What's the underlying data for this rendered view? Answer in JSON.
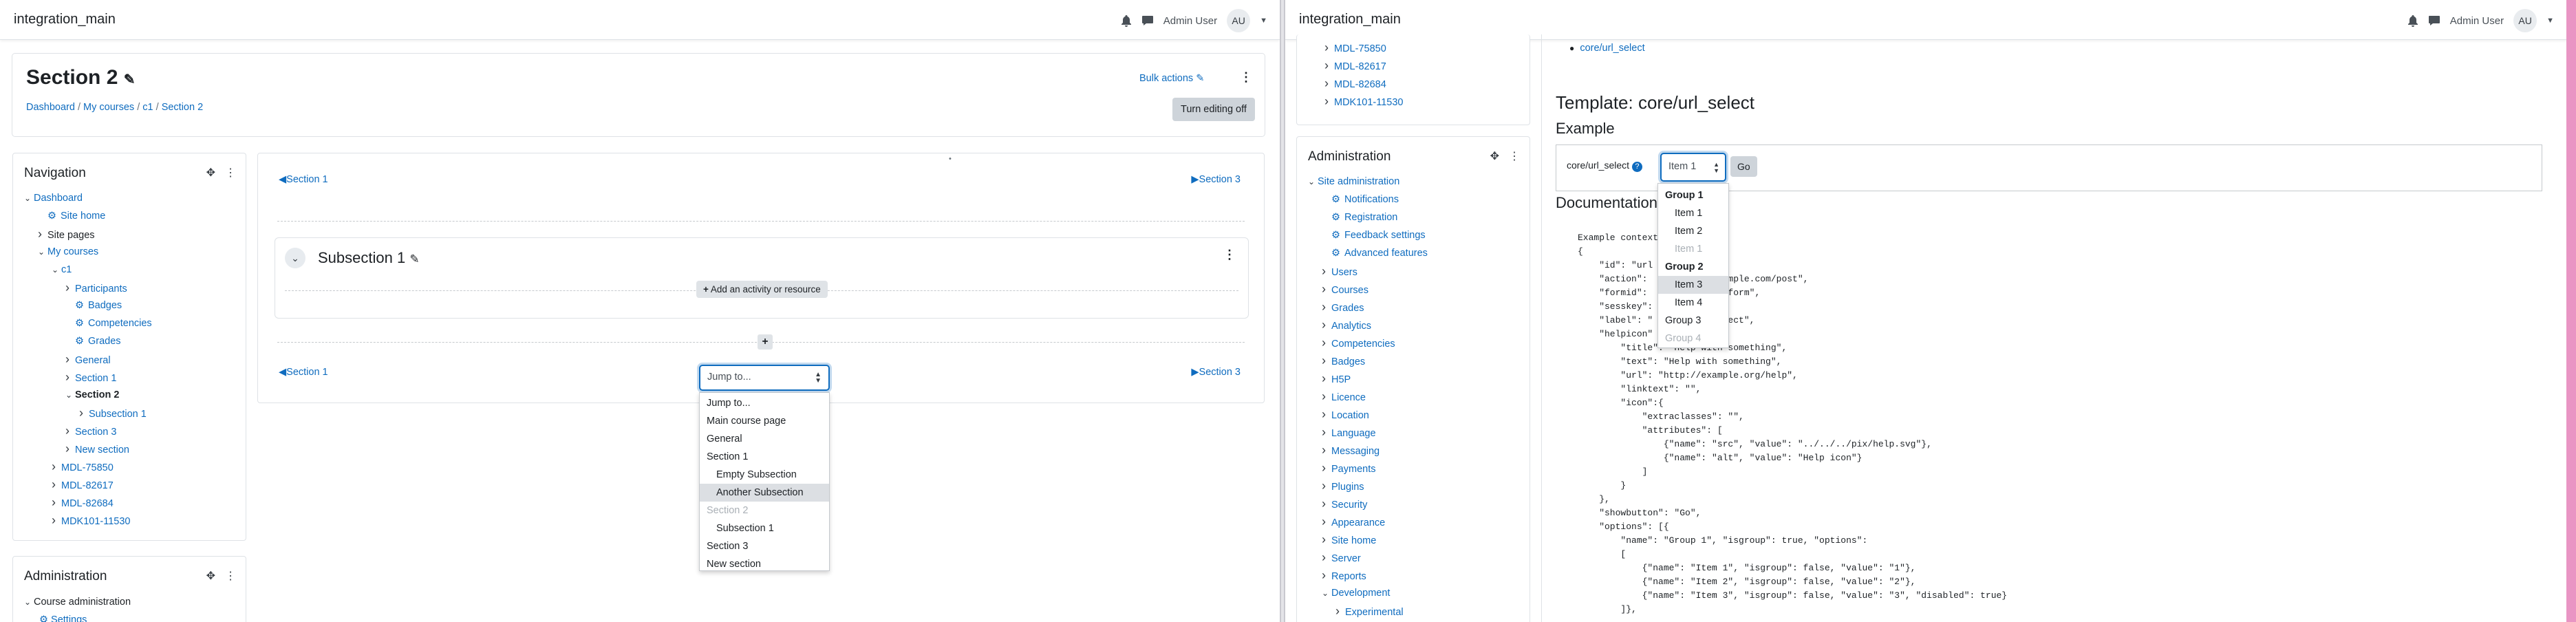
{
  "left": {
    "brand": "integration_main",
    "user": "Admin User",
    "avatar": "AU",
    "page_title": "Section 2",
    "bulk_actions": "Bulk actions",
    "turn_editing": "Turn editing off",
    "breadcrumb": [
      "Dashboard",
      "My courses",
      "c1",
      "Section 2"
    ],
    "nav": {
      "title": "Navigation",
      "items": [
        {
          "t": "Dashboard",
          "lvl": 0,
          "chev": "v"
        },
        {
          "t": "Site home",
          "lvl": 1,
          "chev": "",
          "icon": true
        },
        {
          "t": "Site pages",
          "lvl": 1,
          "chev": ">",
          "dark": true
        },
        {
          "t": "My courses",
          "lvl": 1,
          "chev": "v"
        },
        {
          "t": "c1",
          "lvl": 2,
          "chev": "v"
        },
        {
          "t": "Participants",
          "lvl": 3,
          "chev": ">"
        },
        {
          "t": "Badges",
          "lvl": 3,
          "chev": "",
          "icon": true
        },
        {
          "t": "Competencies",
          "lvl": 3,
          "chev": "",
          "icon": true
        },
        {
          "t": "Grades",
          "lvl": 3,
          "chev": "",
          "icon": true
        },
        {
          "t": "General",
          "lvl": 3,
          "chev": ">"
        },
        {
          "t": "Section 1",
          "lvl": 3,
          "chev": ">"
        },
        {
          "t": "Section 2",
          "lvl": 3,
          "chev": "v",
          "bold": true
        },
        {
          "t": "Subsection 1",
          "lvl": 4,
          "chev": ">"
        },
        {
          "t": "Section 3",
          "lvl": 3,
          "chev": ">"
        },
        {
          "t": "New section",
          "lvl": 3,
          "chev": ">"
        },
        {
          "t": "MDL-75850",
          "lvl": 2,
          "chev": ">"
        },
        {
          "t": "MDL-82617",
          "lvl": 2,
          "chev": ">"
        },
        {
          "t": "MDL-82684",
          "lvl": 2,
          "chev": ">"
        },
        {
          "t": "MDK101-11530",
          "lvl": 2,
          "chev": ">"
        }
      ]
    },
    "admin": {
      "title": "Administration",
      "items": [
        "Course administration",
        "Settings"
      ]
    },
    "section_nav": {
      "prev": "Section 1",
      "next": "Section 3"
    },
    "subsection_title": "Subsection 1",
    "add_activity": "Add an activity or resource",
    "jump": {
      "placeholder": "Jump to...",
      "options": [
        {
          "t": "Jump to...",
          "s": ""
        },
        {
          "t": "Main course page",
          "s": ""
        },
        {
          "t": "General",
          "s": ""
        },
        {
          "t": "Section 1",
          "s": ""
        },
        {
          "t": "Empty Subsection",
          "s": "ind"
        },
        {
          "t": "Another Subsection",
          "s": "ind sel"
        },
        {
          "t": "Section 2",
          "s": "dis"
        },
        {
          "t": "Subsection 1",
          "s": "ind"
        },
        {
          "t": "Section 3",
          "s": ""
        },
        {
          "t": "New section",
          "s": ""
        }
      ]
    }
  },
  "right": {
    "brand": "integration_main",
    "user": "Admin User",
    "avatar": "AU",
    "nav_tail": [
      "MDL-75850",
      "MDL-82617",
      "MDL-82684",
      "MDK101-11530"
    ],
    "admin": {
      "title": "Administration",
      "items": [
        {
          "t": "Site administration",
          "chev": "v",
          "lvl": 0
        },
        {
          "t": "Notifications",
          "chev": "",
          "icon": true,
          "lvl": 1
        },
        {
          "t": "Registration",
          "chev": "",
          "icon": true,
          "lvl": 1
        },
        {
          "t": "Feedback settings",
          "chev": "",
          "icon": true,
          "lvl": 1
        },
        {
          "t": "Advanced features",
          "chev": "",
          "icon": true,
          "lvl": 1
        },
        {
          "t": "Users",
          "chev": ">",
          "lvl": 1
        },
        {
          "t": "Courses",
          "chev": ">",
          "lvl": 1
        },
        {
          "t": "Grades",
          "chev": ">",
          "lvl": 1
        },
        {
          "t": "Analytics",
          "chev": ">",
          "lvl": 1
        },
        {
          "t": "Competencies",
          "chev": ">",
          "lvl": 1
        },
        {
          "t": "Badges",
          "chev": ">",
          "lvl": 1
        },
        {
          "t": "H5P",
          "chev": ">",
          "lvl": 1
        },
        {
          "t": "Licence",
          "chev": ">",
          "lvl": 1
        },
        {
          "t": "Location",
          "chev": ">",
          "lvl": 1
        },
        {
          "t": "Language",
          "chev": ">",
          "lvl": 1
        },
        {
          "t": "Messaging",
          "chev": ">",
          "lvl": 1
        },
        {
          "t": "Payments",
          "chev": ">",
          "lvl": 1
        },
        {
          "t": "Plugins",
          "chev": ">",
          "lvl": 1
        },
        {
          "t": "Security",
          "chev": ">",
          "lvl": 1
        },
        {
          "t": "Appearance",
          "chev": ">",
          "lvl": 1
        },
        {
          "t": "Site home",
          "chev": ">",
          "lvl": 1
        },
        {
          "t": "Server",
          "chev": ">",
          "lvl": 1
        },
        {
          "t": "Reports",
          "chev": ">",
          "lvl": 1
        },
        {
          "t": "Development",
          "chev": "v",
          "lvl": 1
        },
        {
          "t": "Experimental",
          "chev": ">",
          "lvl": 2
        }
      ]
    },
    "link_top": "core/url_select",
    "template_title": "Template: core/url_select",
    "example_heading": "Example",
    "url_select_label": "core/url_select",
    "select_value": "Item 1",
    "go": "Go",
    "documentation": "Documentation",
    "options": [
      {
        "t": "Group 1",
        "s": "grp"
      },
      {
        "t": "Item 1",
        "s": "ind"
      },
      {
        "t": "Item 2",
        "s": "ind"
      },
      {
        "t": "Item 1",
        "s": "ind dis"
      },
      {
        "t": "Group 2",
        "s": "grp"
      },
      {
        "t": "Item 3",
        "s": "ind sel"
      },
      {
        "t": "Item 4",
        "s": "ind"
      },
      {
        "t": "Group 3",
        "s": ""
      },
      {
        "t": "Group 4",
        "s": "dis"
      }
    ],
    "code": [
      "Example context",
      "{",
      "    \"id\": \"url",
      "    \"action\":               mple.com/post\",",
      "    \"formid\":               form\",",
      "    \"sesskey\":",
      "    \"label\": \"              ect\",",
      "    \"helpicon\"",
      "        \"title\": \"Help with something\",",
      "        \"text\": \"Help with something\",",
      "        \"url\": \"http://example.org/help\",",
      "        \"linktext\": \"\",",
      "        \"icon\":{",
      "            \"extraclasses\": \"\",",
      "            \"attributes\": [",
      "                {\"name\": \"src\", \"value\": \"../../../pix/help.svg\"},",
      "                {\"name\": \"alt\", \"value\": \"Help icon\"}",
      "            ]",
      "        }",
      "    },",
      "    \"showbutton\": \"Go\",",
      "    \"options\": [{",
      "        \"name\": \"Group 1\", \"isgroup\": true, \"options\":",
      "        [",
      "            {\"name\": \"Item 1\", \"isgroup\": false, \"value\": \"1\"},",
      "            {\"name\": \"Item 2\", \"isgroup\": false, \"value\": \"2\"},",
      "            {\"name\": \"Item 3\", \"isgroup\": false, \"value\": \"3\", \"disabled\": true}",
      "        ]},"
    ]
  }
}
